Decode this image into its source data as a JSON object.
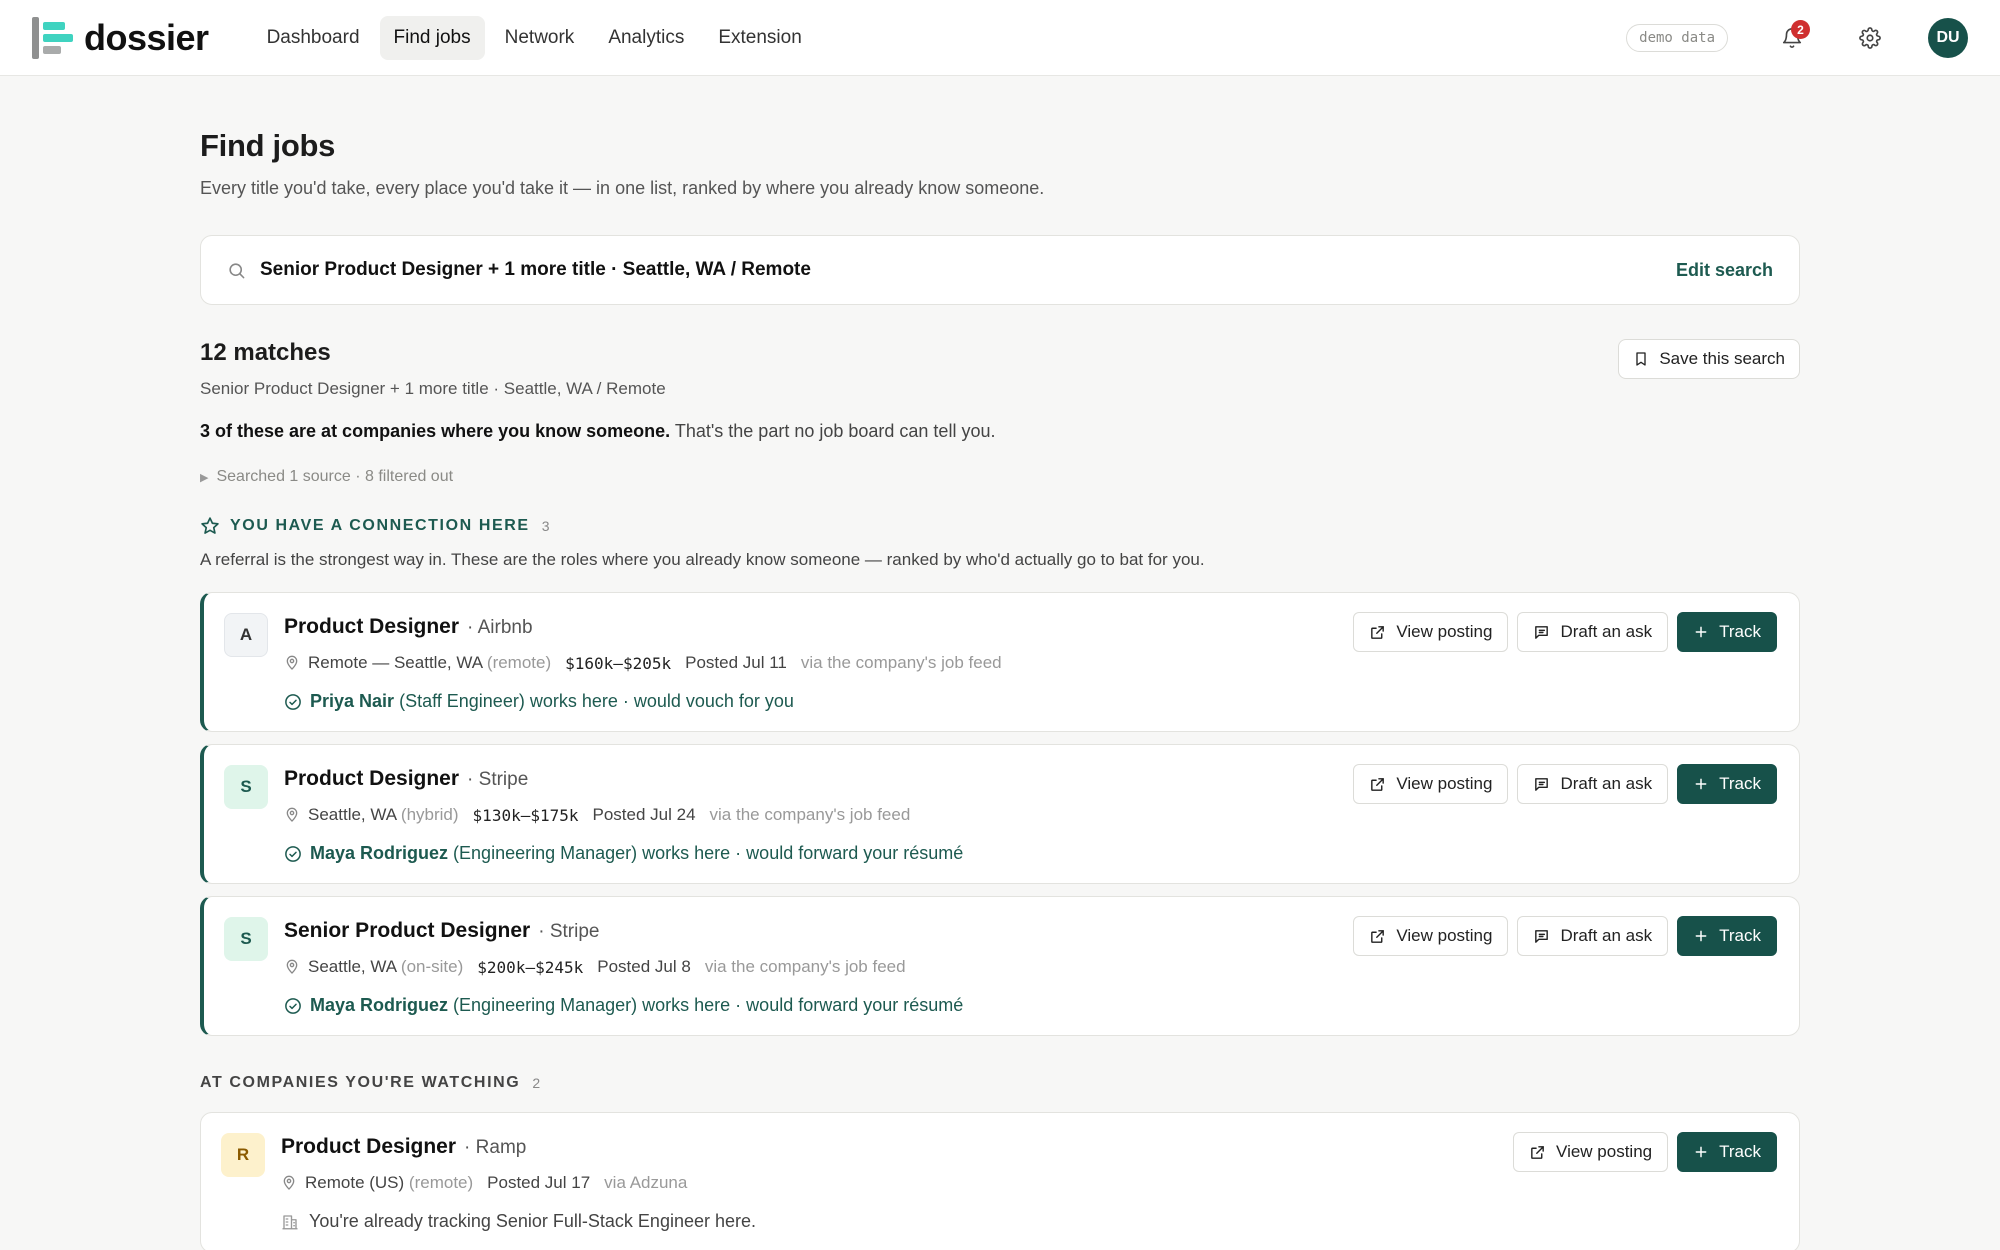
{
  "app": {
    "brand": "dossier"
  },
  "nav": {
    "items": [
      {
        "label": "Dashboard"
      },
      {
        "label": "Find jobs",
        "active": true
      },
      {
        "label": "Network"
      },
      {
        "label": "Analytics"
      },
      {
        "label": "Extension"
      }
    ]
  },
  "topbar": {
    "demo_pill": "demo data",
    "notification_count": "2",
    "avatar_initials": "DU",
    "icons": [
      "bell-icon",
      "gear-icon"
    ]
  },
  "page": {
    "title": "Find jobs",
    "subtitle": "Every title you'd take, every place you'd take it — in one list, ranked by where you already know someone."
  },
  "search": {
    "summary": "Senior Product Designer + 1 more title · Seattle, WA / Remote",
    "edit_label": "Edit search"
  },
  "results": {
    "count_label": "12 matches",
    "sub": "Senior Product Designer + 1 more title · Seattle, WA / Remote",
    "note_bold": "3 of these are at companies where you know someone.",
    "note_rest": " That's the part no job board can tell you.",
    "save_label": "Save this search",
    "sources": "Searched 1 source · 8 filtered out"
  },
  "sections": {
    "connection": {
      "label": "YOU HAVE A CONNECTION HERE",
      "count": "3",
      "desc": "A referral is the strongest way in. These are the roles where you already know someone — ranked by who'd actually go to bat for you."
    },
    "watching": {
      "label": "AT COMPANIES YOU'RE WATCHING",
      "count": "2"
    }
  },
  "buttons": {
    "view_posting": "View posting",
    "draft_ask": "Draft an ask",
    "track": "Track"
  },
  "connection_jobs": [
    {
      "initial": "A",
      "title": "Product Designer",
      "company": "· Airbnb",
      "location": "Remote — Seattle, WA",
      "mode": "(remote)",
      "salary": "$160k–$205k",
      "posted": "Posted Jul 11",
      "via": "via the company's job feed",
      "contact_name": "Priya Nair",
      "contact_rest": "(Staff Engineer) works here · would vouch for you"
    },
    {
      "initial": "S",
      "title": "Product Designer",
      "company": "· Stripe",
      "location": "Seattle, WA",
      "mode": "(hybrid)",
      "salary": "$130k–$175k",
      "posted": "Posted Jul 24",
      "via": "via the company's job feed",
      "contact_name": "Maya Rodriguez",
      "contact_rest": "(Engineering Manager) works here · would forward your résumé"
    },
    {
      "initial": "S",
      "title": "Senior Product Designer",
      "company": "· Stripe",
      "location": "Seattle, WA",
      "mode": "(on-site)",
      "salary": "$200k–$245k",
      "posted": "Posted Jul 8",
      "via": "via the company's job feed",
      "contact_name": "Maya Rodriguez",
      "contact_rest": "(Engineering Manager) works here · would forward your résumé"
    }
  ],
  "watching_jobs": [
    {
      "initial": "R",
      "title": "Product Designer",
      "company": "· Ramp",
      "location": "Remote (US)",
      "mode": "(remote)",
      "posted": "Posted Jul 17",
      "via": "via Adzuna",
      "info": "You're already tracking Senior Full-Stack Engineer here."
    }
  ],
  "colors": {
    "accent": "#17514a",
    "accent_text": "#1d5a50",
    "badge_red": "#cf2f2f",
    "logo_gray": "#8f9090",
    "logo_teal": "#3fd3c0"
  }
}
